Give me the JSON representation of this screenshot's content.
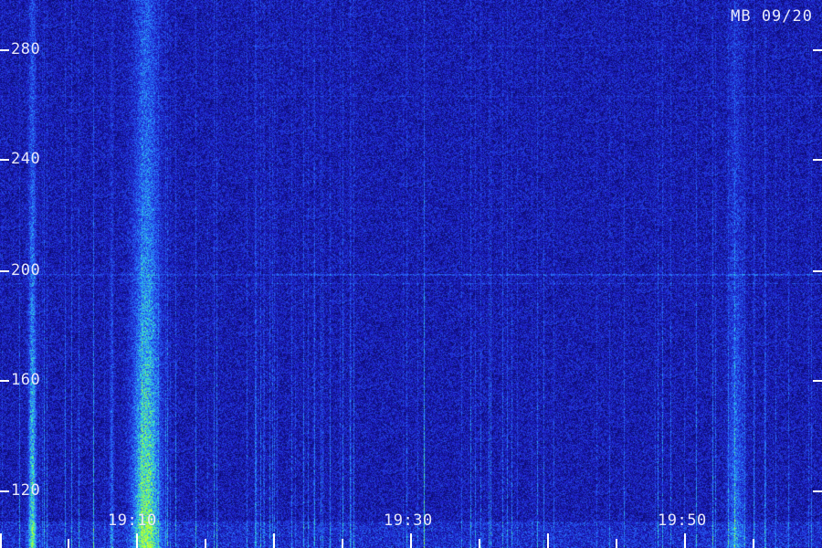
{
  "station_label": "MB 09/20",
  "y_axis": {
    "ticks": [
      "280",
      "240",
      "200",
      "160",
      "120"
    ]
  },
  "x_axis": {
    "ticks": [
      "19:10",
      "19:30",
      "19:50"
    ]
  },
  "colors": {
    "background": "#0a0a6a",
    "noise_low": "#1a1a9a",
    "noise_high": "#3a6aff",
    "signal_cyan": "#20c0ff",
    "signal_green": "#60ff60",
    "signal_yellow": "#d0ff40",
    "label": "#e8e8f8",
    "tick": "#ffffff"
  }
}
